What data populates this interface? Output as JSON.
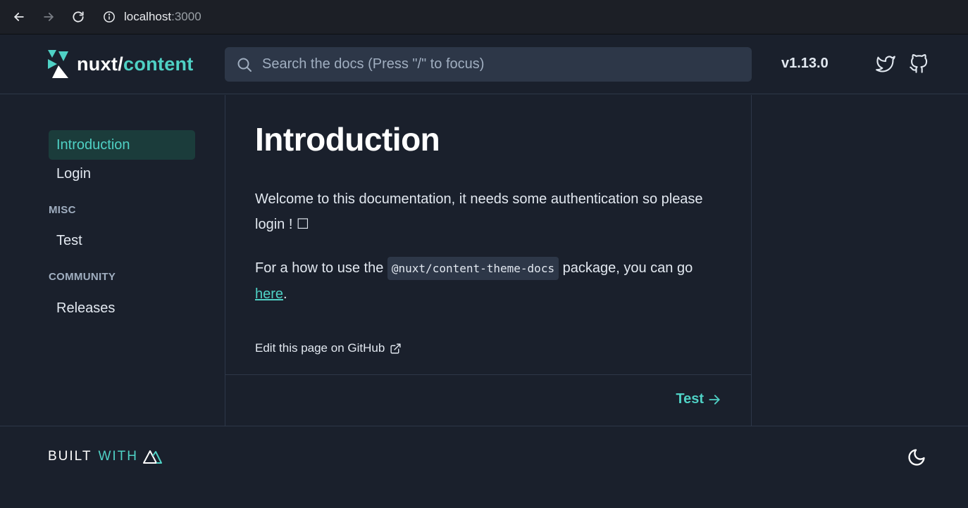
{
  "browser": {
    "url_host": "localhost",
    "url_port": ":3000",
    "icons": [
      "back-arrow-icon",
      "forward-arrow-icon",
      "reload-icon",
      "info-icon"
    ]
  },
  "header": {
    "logo_prefix": "nuxt/",
    "logo_suffix": "content",
    "search_placeholder": "Search the docs (Press \"/\" to focus)",
    "version": "v1.13.0",
    "icons": [
      "search-icon",
      "twitter-icon",
      "github-icon"
    ]
  },
  "sidebar": {
    "items": [
      {
        "label": "Introduction",
        "active": true
      },
      {
        "label": "Login",
        "active": false
      }
    ],
    "sections": [
      {
        "title": "MISC",
        "items": [
          {
            "label": "Test"
          }
        ]
      },
      {
        "title": "COMMUNITY",
        "items": [
          {
            "label": "Releases"
          }
        ]
      }
    ]
  },
  "main": {
    "title": "Introduction",
    "p1": "Welcome to this documentation, it needs some authentication so please login ! ☐",
    "p2_before": "For a how to use the",
    "p2_code": "@nuxt/content-theme-docs",
    "p2_middle": "package, you can go",
    "p2_link": "here",
    "p2_after": ".",
    "edit_link": "Edit this page on GitHub",
    "next_link": "Test"
  },
  "footer": {
    "built": "BUILT",
    "with": "WITH",
    "icons": [
      "nuxt-logo-icon",
      "moon-icon"
    ]
  },
  "colors": {
    "background": "#1a202c",
    "accent": "#4fd1c5",
    "border": "#2d3748",
    "search_bg": "#2d3748",
    "active_bg": "#1b3c3b"
  }
}
